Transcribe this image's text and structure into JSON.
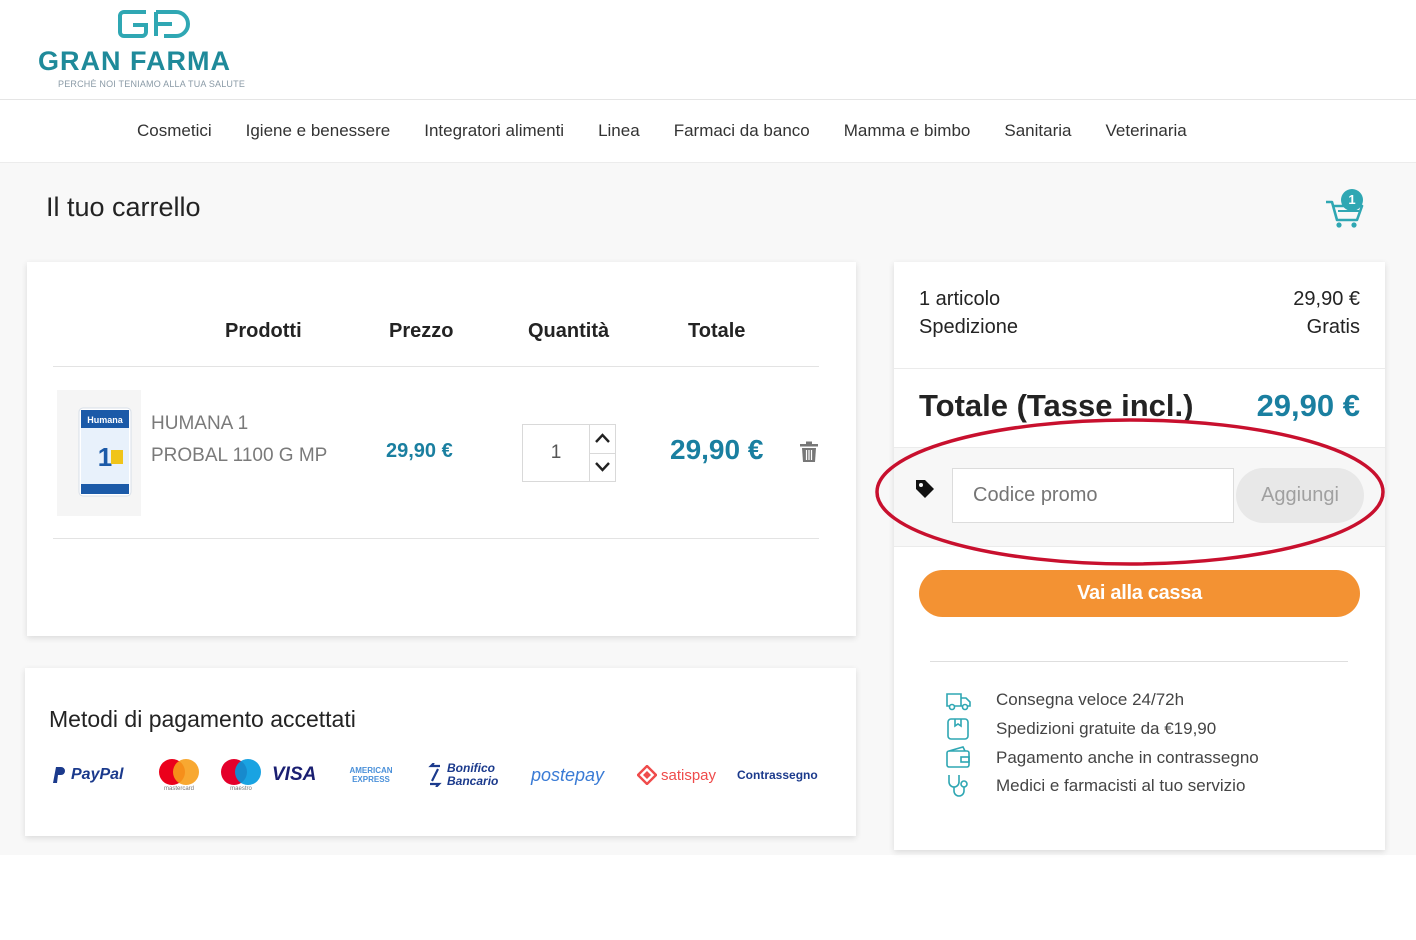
{
  "brand": {
    "name": "GRAN FARMA",
    "tagline": "PERCHÈ NOI TENIAMO ALLA TUA SALUTE",
    "mark": "GF",
    "color": "#1f8a9a"
  },
  "nav": {
    "items": [
      "Cosmetici",
      "Igiene e benessere",
      "Integratori alimenti",
      "Linea",
      "Farmaci da banco",
      "Mamma e bimbo",
      "Sanitaria",
      "Veterinaria"
    ]
  },
  "page": {
    "title": "Il tuo carrello",
    "cart_count": "1"
  },
  "cart": {
    "headers": {
      "products": "Prodotti",
      "price": "Prezzo",
      "quantity": "Quantità",
      "total": "Totale"
    },
    "item": {
      "name_line1": "HUMANA 1",
      "name_line2": "PROBAL 1100 G MP",
      "price": "29,90 €",
      "quantity": "1",
      "total": "29,90 €",
      "image_brand": "Humana",
      "image_number": "1"
    }
  },
  "payment": {
    "title": "Metodi di pagamento accettati",
    "methods": [
      "PayPal",
      "mastercard",
      "maestro",
      "VISA",
      "AMERICAN EXPRESS",
      "Bonifico Bancario",
      "postepay",
      "satispay",
      "Contrassegno"
    ]
  },
  "summary": {
    "articles_label": "1 articolo",
    "articles_value": "29,90 €",
    "shipping_label": "Spedizione",
    "shipping_value": "Gratis",
    "total_label": "Totale (Tasse incl.)",
    "total_value": "29,90 €",
    "promo_placeholder": "Codice promo",
    "promo_button": "Aggiungi",
    "checkout_button": "Vai alla cassa",
    "features": [
      {
        "icon": "truck-icon",
        "text": "Consegna veloce 24/72h"
      },
      {
        "icon": "package-icon",
        "text": "Spedizioni gratuite da €19,90"
      },
      {
        "icon": "wallet-icon",
        "text": "Pagamento anche in contrassegno"
      },
      {
        "icon": "stethoscope-icon",
        "text": "Medici e farmacisti al tuo servizio"
      }
    ]
  },
  "colors": {
    "accent": "#1a7fa0",
    "checkout": "#f39233",
    "highlight": "#c8102e"
  }
}
